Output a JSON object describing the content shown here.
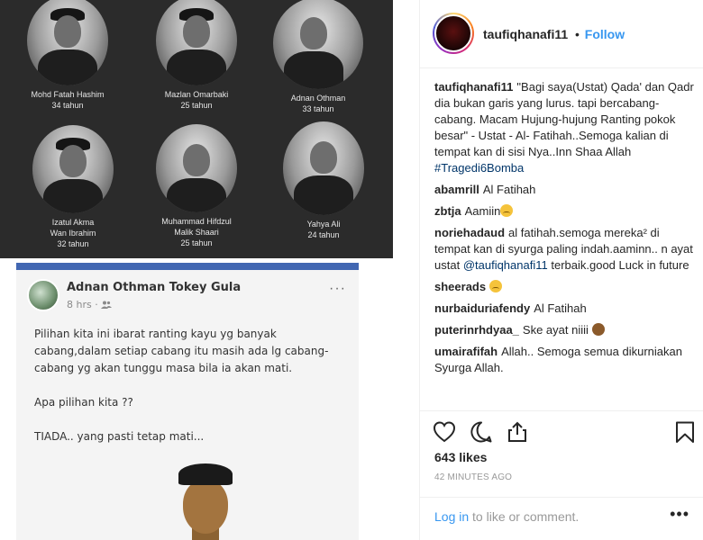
{
  "memorial": {
    "people": [
      {
        "name": "Mohd Fatah Hashim",
        "age": "34 tahun"
      },
      {
        "name": "Mazlan Omarbaki",
        "age": "25 tahun"
      },
      {
        "name": "Adnan Othman",
        "age": "33 tahun"
      },
      {
        "name": "Izatul Akma\nWan Ibrahim",
        "age": "32 tahun"
      },
      {
        "name": "Muhammad Hifdzul\nMalik Shaari",
        "age": "25 tahun"
      },
      {
        "name": "Yahya Ali",
        "age": "24 tahun"
      }
    ]
  },
  "fb_post": {
    "author": "Adnan Othman Tokey Gula",
    "time": "8 hrs · ",
    "paragraph1": "Pilihan kita ini ibarat ranting kayu yg banyak cabang,dalam setiap cabang itu masih ada lg cabang-cabang yg akan tunggu masa bila ia akan mati.",
    "paragraph2": "Apa pilihan kita ??",
    "paragraph3": "TIADA.. yang pasti tetap mati...",
    "more": "···"
  },
  "ig": {
    "username": "taufiqhanafi11",
    "separator": "•",
    "follow_label": "Follow",
    "caption_user": "taufiqhanafi11",
    "caption_text": "\"Bagi saya(Ustat) Qada' dan Qadr dia bukan garis yang lurus. tapi bercabang-cabang. Macam Hujung-hujung Ranting pokok besar\" - Ustat - Al- Fatihah..Semoga kalian di tempat kan di sisi Nya..Inn Shaa Allah",
    "caption_hashtag": "#Tragedi6Bomba",
    "comments": [
      {
        "user": "abamrill",
        "text": "Al Fatihah"
      },
      {
        "user": "zbtja",
        "text": "Aamiin"
      },
      {
        "user": "noriehadaud",
        "text": "al fatihah.semoga mereka² di tempat kan di syurga paling indah.aaminn.. n ayat ustat",
        "mention": "@taufiqhanafi11",
        "text_after": "terbaik.good Luck in future"
      },
      {
        "user": "sheerads",
        "text": ""
      },
      {
        "user": "nurbaiduriafendy",
        "text": "Al Fatihah"
      },
      {
        "user": "puterinrhdyaa_",
        "text": "Ske ayat niiii"
      },
      {
        "user": "umairafifah",
        "text": "Allah.. Semoga semua dikurniakan Syurga Allah."
      }
    ],
    "likes": "643 likes",
    "time_ago": "42 MINUTES AGO",
    "login_link": "Log in",
    "login_text": " to like or comment.",
    "more": "•••"
  },
  "icons": [
    "heart-icon",
    "comment-icon",
    "share-icon",
    "bookmark-icon"
  ],
  "colors": {
    "accent": "#3897f0",
    "fb_blue": "#4267b2",
    "memorial_bg": "#2b2b2b"
  }
}
